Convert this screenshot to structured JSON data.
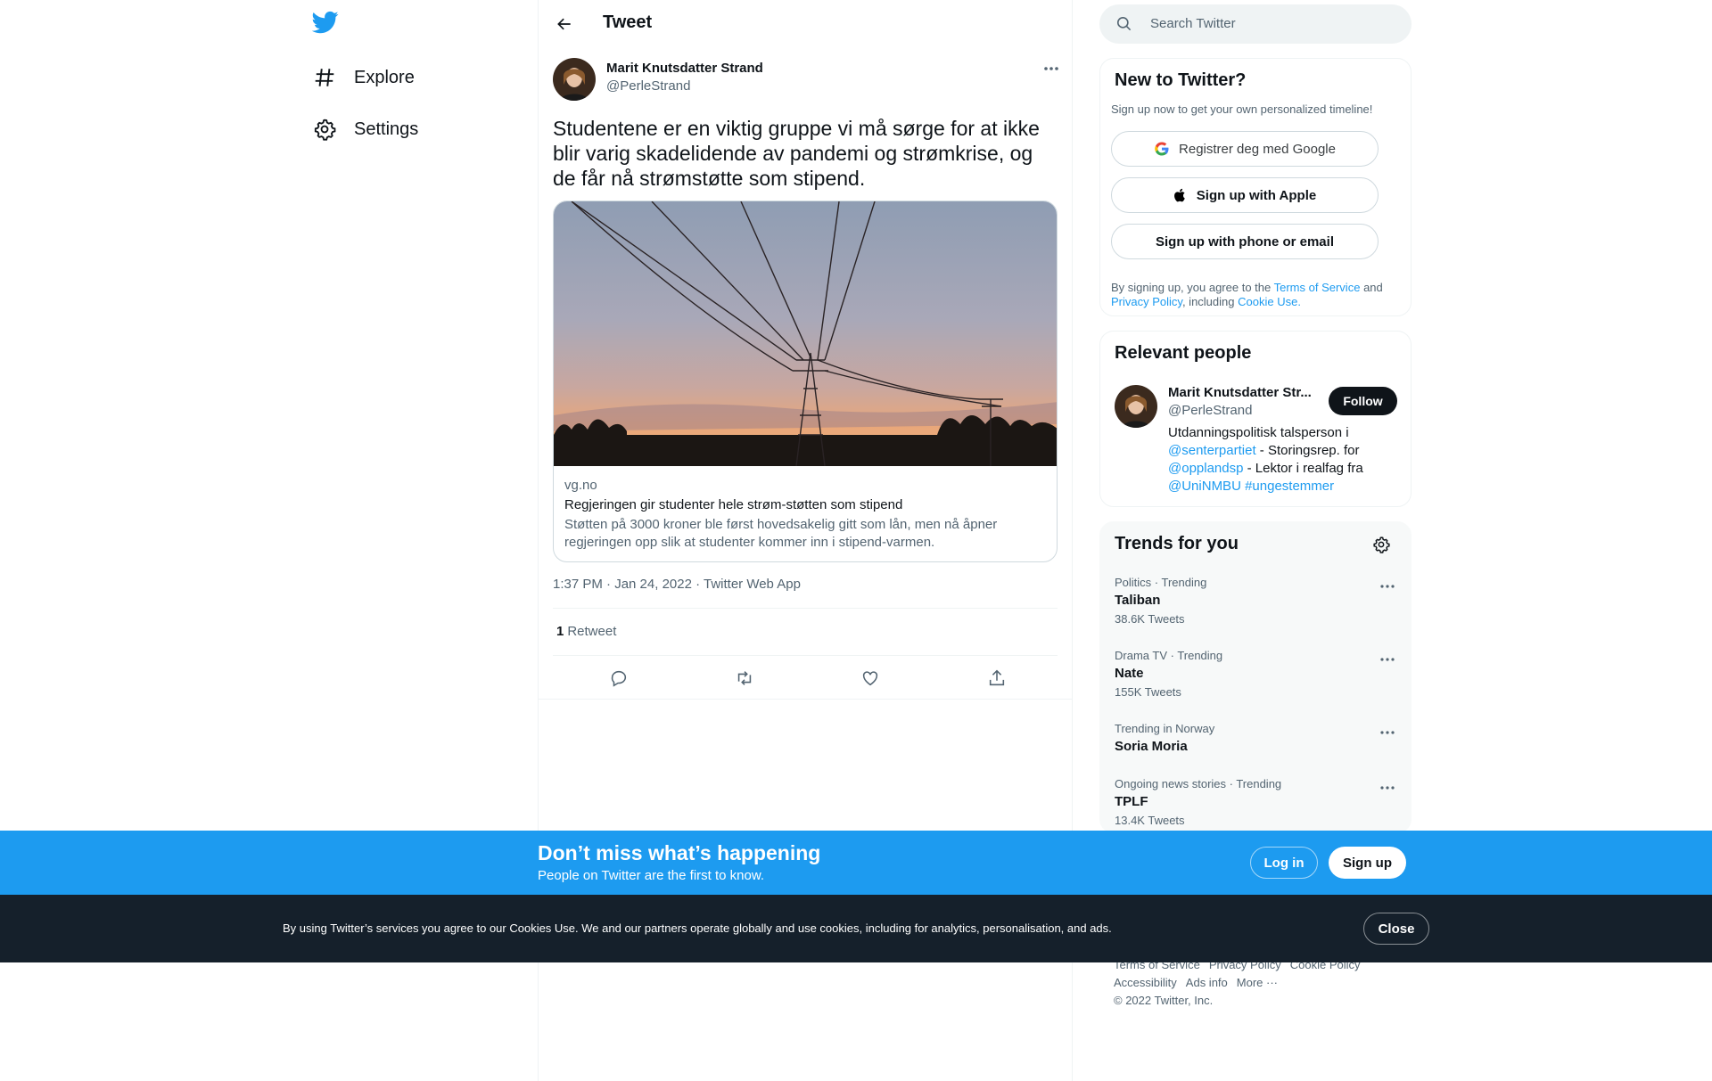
{
  "nav": {
    "items": [
      {
        "label": "Explore",
        "icon": "hashtag-icon"
      },
      {
        "label": "Settings",
        "icon": "gear-icon"
      }
    ]
  },
  "header": {
    "title": "Tweet"
  },
  "tweet": {
    "author_name": "Marit Knutsdatter Strand",
    "author_handle": "@PerleStrand",
    "text": "Studentene er en viktig gruppe vi må sørge for at ikke blir varig skadelidende av pandemi og strømkrise, og de får nå strømstøtte som stipend.",
    "card": {
      "domain": "vg.no",
      "title": "Regjeringen gir studenter hele strøm-støtten som stipend",
      "description": "Støtten på 3000 kroner ble først hovedsakelig gitt som lån, men nå åpner regjeringen opp slik at studenter kommer inn i stipend-varmen."
    },
    "time": "1:37 PM · Jan 24, 2022 · Twitter Web App",
    "retweet_count": "1",
    "retweet_label": "Retweet"
  },
  "search": {
    "placeholder": "Search Twitter"
  },
  "signup_box": {
    "title": "New to Twitter?",
    "subtitle": "Sign up now to get your own personalized timeline!",
    "google_label": "Registrer deg med Google",
    "apple_label": "Sign up with Apple",
    "phone_label": "Sign up with phone or email",
    "legal_prefix": "By signing up, you agree to the",
    "terms": "Terms of Service",
    "and": "and",
    "privacy": "Privacy Policy",
    "including": ", including",
    "cookie": "Cookie Use."
  },
  "relevant": {
    "title": "Relevant people",
    "name": "Marit Knutsdatter Str...",
    "handle": "@PerleStrand",
    "follow_label": "Follow",
    "bio_1": "Utdanningspolitisk talsperson i",
    "bio_link1": "@senterpartiet",
    "bio_2": " - Storingsrep. for",
    "bio_link2": "@opplandsp",
    "bio_3": " - Lektor i realfag fra",
    "bio_link3": "@UniNMBU",
    "bio_link4": "#ungestemmer"
  },
  "trends": {
    "title": "Trends for you",
    "items": [
      {
        "context": "Politics · Trending",
        "name": "Taliban",
        "count": "38.6K Tweets"
      },
      {
        "context": "Drama TV · Trending",
        "name": "Nate",
        "count": "155K Tweets"
      },
      {
        "context": "Trending in Norway",
        "name": "Soria Moria",
        "count": ""
      },
      {
        "context": "Ongoing news stories · Trending",
        "name": "TPLF",
        "count": "13.4K Tweets"
      }
    ]
  },
  "footer": {
    "line1": [
      "Terms of Service",
      "Privacy Policy",
      "Cookie Policy"
    ],
    "line2": [
      "Accessibility",
      "Ads info",
      "More ···"
    ],
    "copyright": "© 2022 Twitter, Inc."
  },
  "bottom_bar": {
    "title": "Don’t miss what’s happening",
    "subtitle": "People on Twitter are the first to know.",
    "login": "Log in",
    "signup": "Sign up"
  },
  "cookie_bar": {
    "text": "By using Twitter’s services you agree to our Cookies Use. We and our partners operate globally and use cookies, including for analytics, personalisation, and ads.",
    "close": "Close"
  },
  "colors": {
    "accent": "#1d9bf0",
    "text": "#0f1419",
    "muted": "#536471",
    "cookie_bg": "#15202b"
  }
}
